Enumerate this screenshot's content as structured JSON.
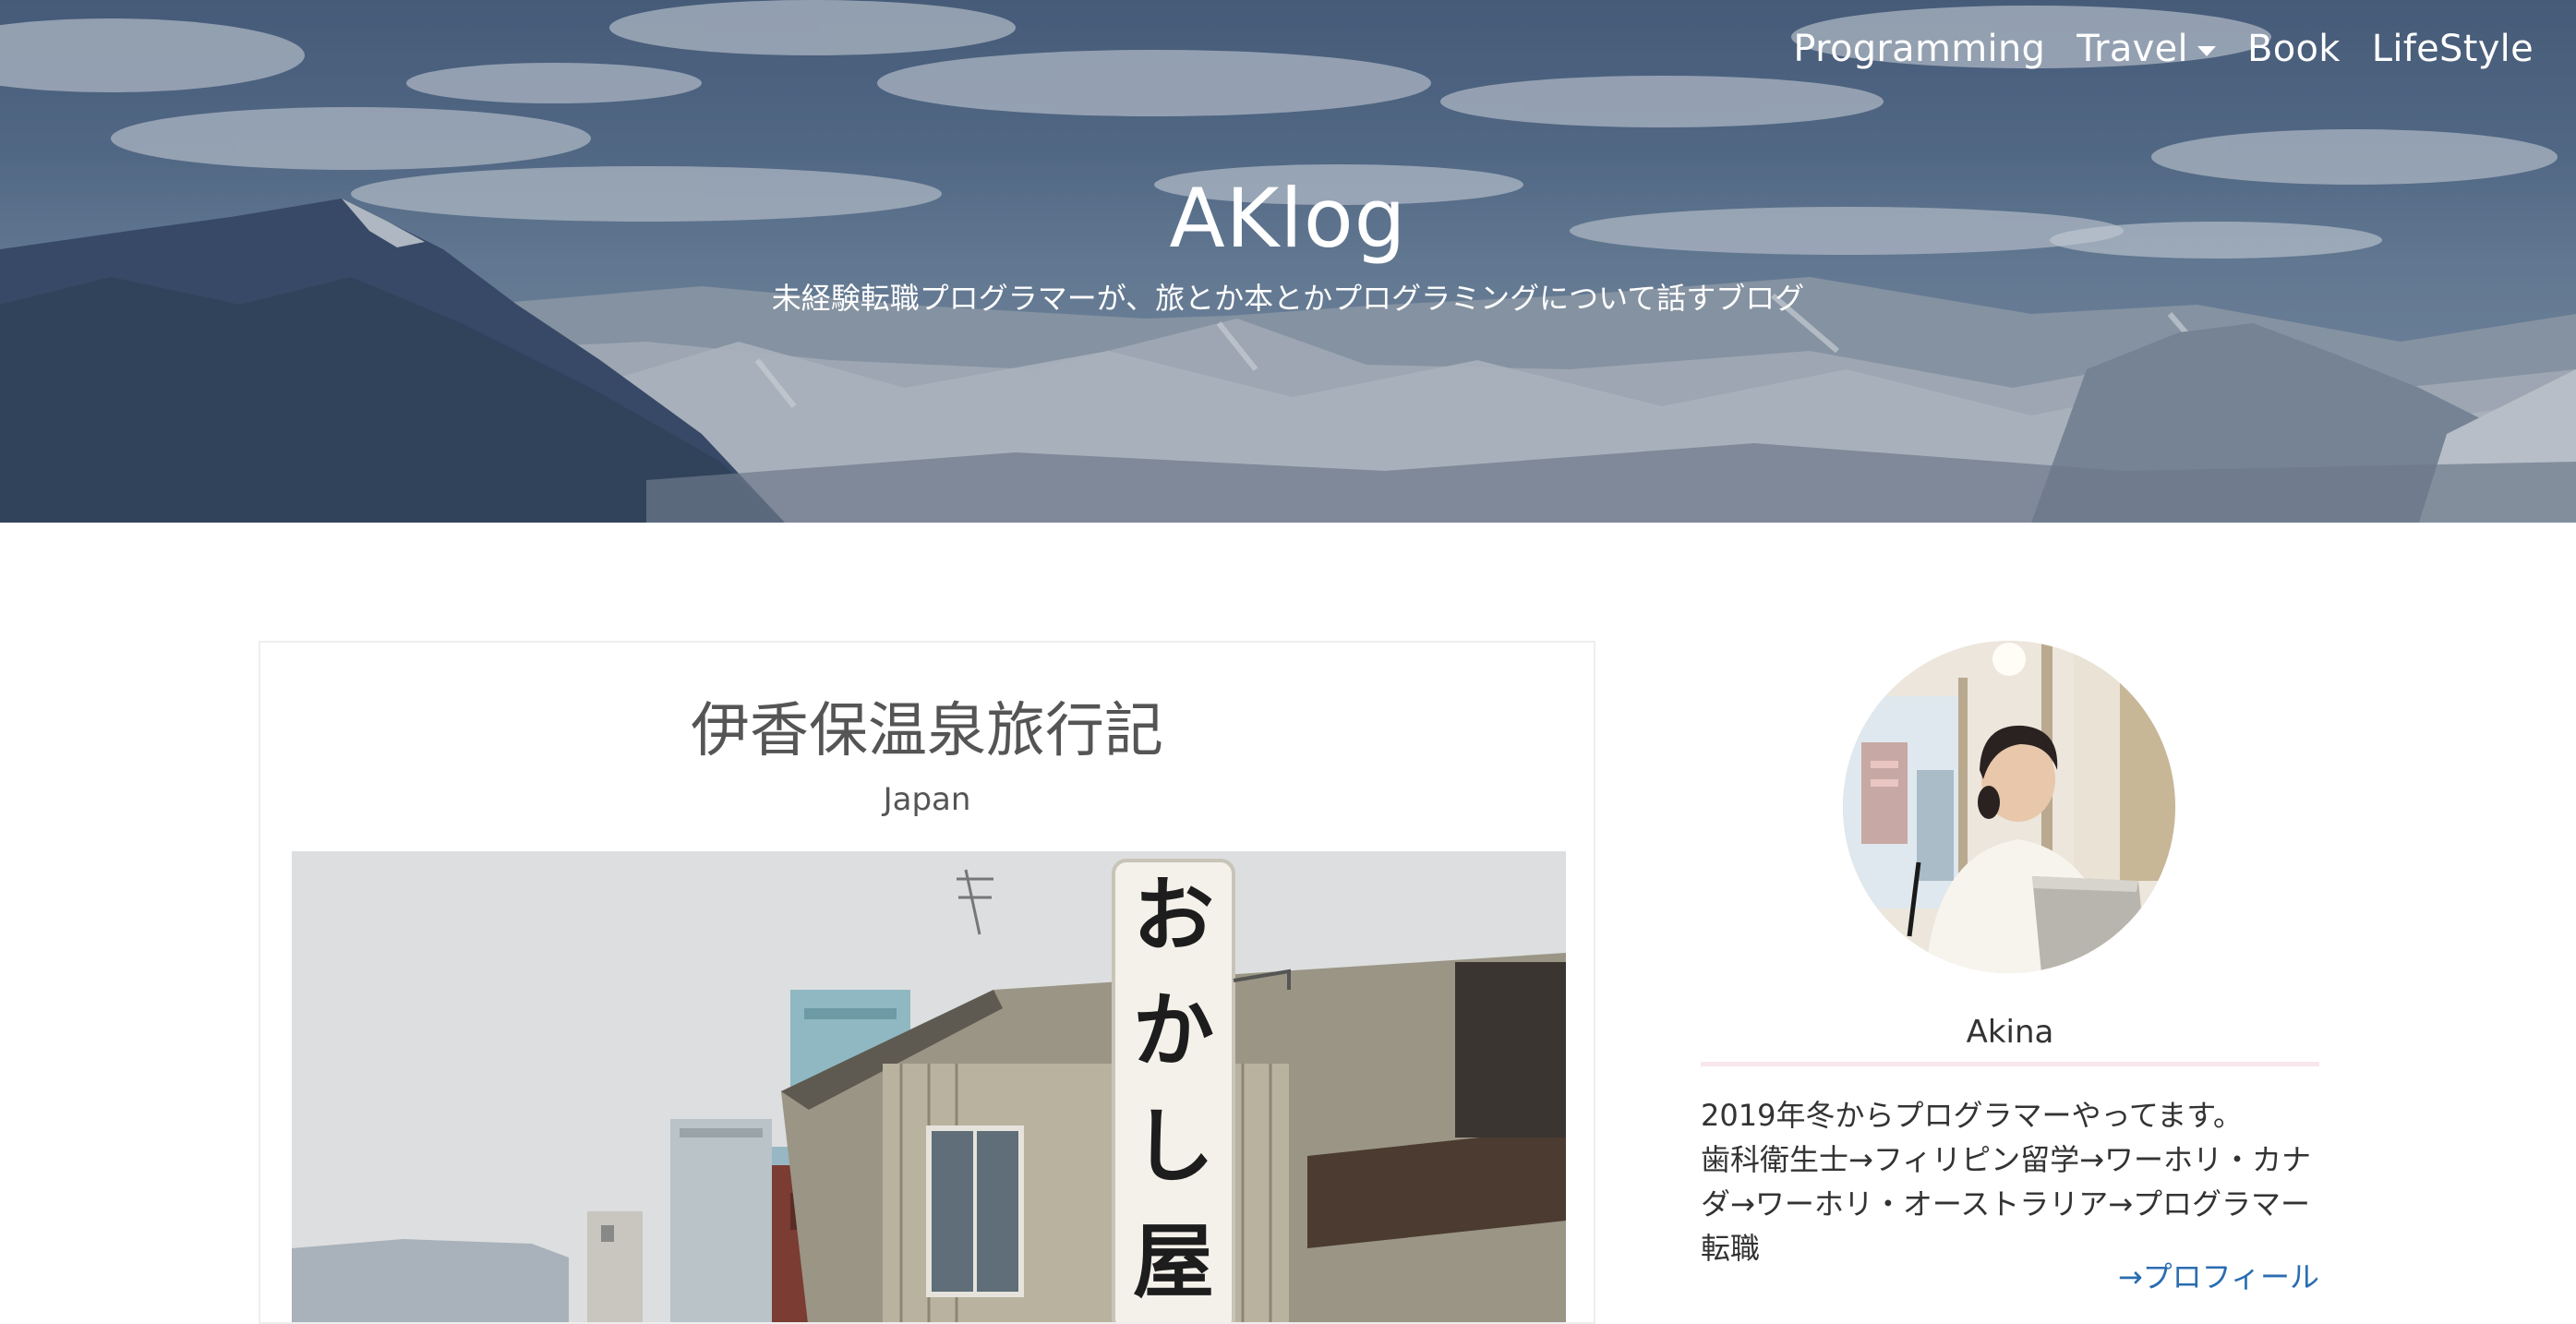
{
  "nav": {
    "items": [
      {
        "label": "Programming"
      },
      {
        "label": "Travel"
      },
      {
        "label": "Book"
      },
      {
        "label": "LifeStyle"
      }
    ]
  },
  "hero": {
    "title": "AKlog",
    "subtitle": "未経験転職プログラマーが、旅とか本とかプログラミングについて話すブログ"
  },
  "post": {
    "title": "伊香保温泉旅行記",
    "category": "Japan",
    "sign_text": "おかし屋"
  },
  "profile": {
    "name": "Akina",
    "bio_line1": "2019年冬からプログラマーやってます。",
    "bio_line2": "歯科衛生士→フィリピン留学→ワーホリ・カナダ→ワーホリ・オーストラリア→プログラマー転職",
    "link_label": "→プロフィール"
  },
  "colors": {
    "link": "#2b6cb0",
    "divider": "#f8e6ea",
    "hero_sky": "#4d6382"
  }
}
